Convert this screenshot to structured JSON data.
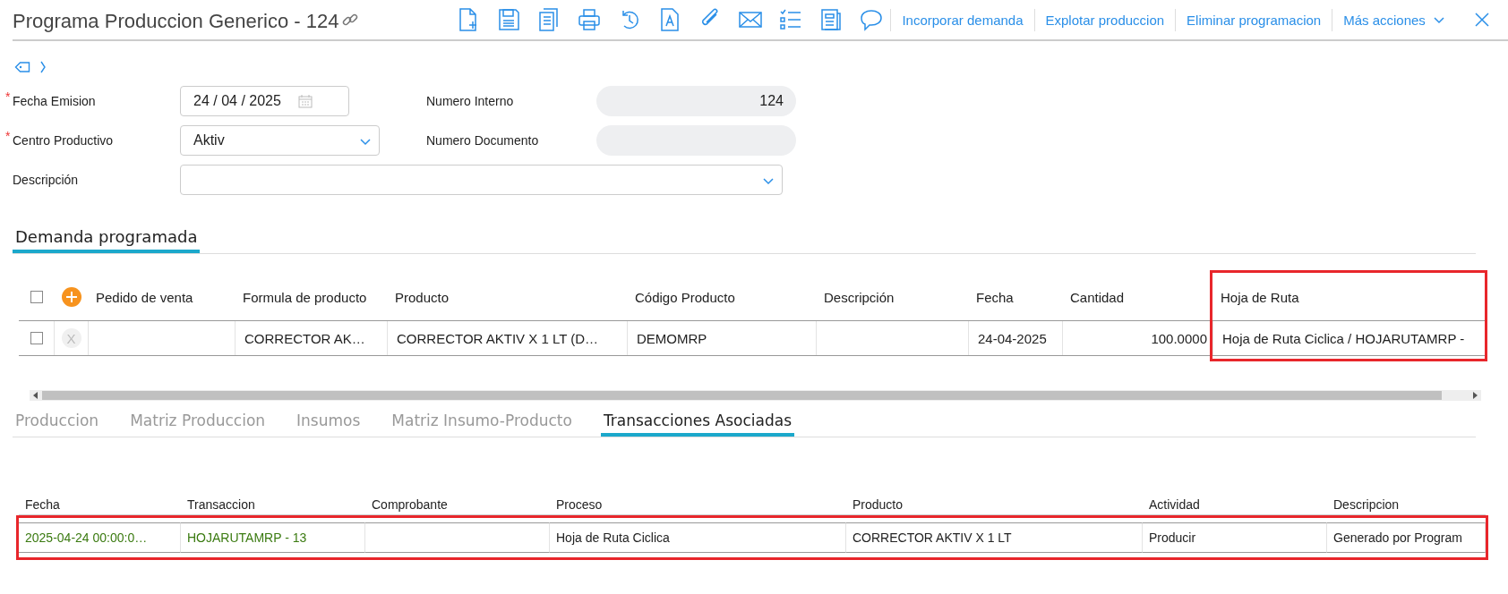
{
  "header": {
    "title": "Programa Produccion Generico - 124",
    "actions": [
      "Incorporar demanda",
      "Explotar produccion",
      "Eliminar programacion"
    ],
    "more_actions": "Más acciones"
  },
  "form": {
    "rows": [
      {
        "fields": [
          {
            "label": "Fecha Emision",
            "required_mark": "*",
            "kind": "date",
            "value": "24 / 04 / 2025"
          },
          {
            "label": "Numero Interno",
            "kind": "readonly",
            "value": "124"
          }
        ]
      },
      {
        "fields": [
          {
            "label": "Centro Productivo",
            "required_mark": "*",
            "kind": "select",
            "value": "Aktiv"
          },
          {
            "label": "Numero Documento",
            "kind": "readonly"
          }
        ]
      },
      {
        "fields": [
          {
            "label": "Descripción",
            "kind": "select_wide"
          }
        ]
      }
    ]
  },
  "section_tab": {
    "label": "Demanda programada",
    "selected": true
  },
  "demand_table": {
    "all_checked": false,
    "columns": [
      {
        "label": "Pedido de venta"
      },
      {
        "label": "Formula de producto"
      },
      {
        "label": "Producto"
      },
      {
        "label": "Código Producto"
      },
      {
        "label": "Descripción"
      },
      {
        "label": "Fecha"
      },
      {
        "label": "Cantidad",
        "numeric": true
      },
      {
        "label": "Hoja de Ruta",
        "highlighted": true
      }
    ],
    "rows": [
      {
        "checked": false,
        "remove_label": "X",
        "cells": [
          null,
          "CORRECTOR AK…",
          "CORRECTOR AKTIV X 1 LT (D…",
          "DEMOMRP",
          null,
          "24-04-2025",
          "100.0000",
          "Hoja de Ruta Ciclica / HOJARUTAMRP -"
        ]
      }
    ]
  },
  "bottom_tabs": [
    {
      "label": "Produccion",
      "selected": false
    },
    {
      "label": "Matriz Produccion",
      "selected": false
    },
    {
      "label": "Insumos",
      "selected": false
    },
    {
      "label": "Matriz Insumo-Producto",
      "selected": false
    },
    {
      "label": "Transacciones Asociadas",
      "selected": true
    }
  ],
  "transactions_table": {
    "columns": [
      {
        "label": "Fecha",
        "link": true
      },
      {
        "label": "Transaccion",
        "link": true
      },
      {
        "label": "Comprobante"
      },
      {
        "label": "Proceso"
      },
      {
        "label": "Producto"
      },
      {
        "label": "Actividad"
      },
      {
        "label": "Descripcion"
      }
    ],
    "rows": [
      {
        "highlighted": true,
        "cells": [
          "2025-04-24 00:00:0…",
          "HOJARUTAMRP - 13",
          null,
          "Hoja de Ruta Ciclica",
          "CORRECTOR AKTIV X 1 LT",
          "Producir",
          "Generado por Program"
        ]
      }
    ]
  }
}
